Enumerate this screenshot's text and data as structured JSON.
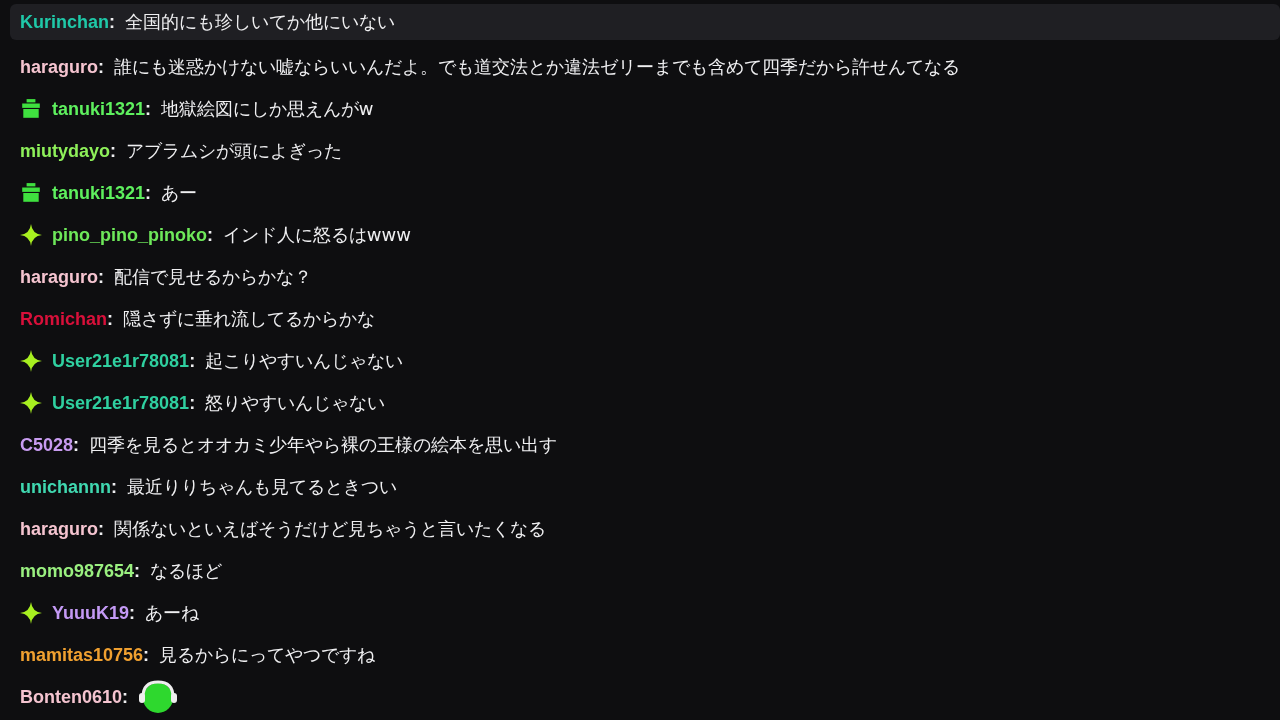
{
  "messages": [
    {
      "name": "Kurinchan",
      "color": "#1fc8a8",
      "kind": "plain",
      "text": "**:** 全国的にも珍しいてか他にいない",
      "highlighted": true
    },
    {
      "name": "haraguro",
      "color": "#f5c4d0",
      "kind": "plain",
      "text": "**:** 誰にも迷惑かけない嘘ならいいんだよ。でも道交法とか違法ゼリーまでも含めて四季だから許せんてなる",
      "highlighted": false
    },
    {
      "name": "tanuki1321",
      "color": "#5ef05e",
      "kind": "gift",
      "text": "**:** 地獄絵図にしか思えんがw",
      "highlighted": false
    },
    {
      "name": "miutydayo",
      "color": "#8ef05a",
      "kind": "plain",
      "text": "**:** アブラムシが頭によぎった",
      "highlighted": false
    },
    {
      "name": "tanuki1321",
      "color": "#5ef05e",
      "kind": "gift",
      "text": "**:** あー",
      "highlighted": false
    },
    {
      "name": "pino_pino_pinoko",
      "color": "#6ee85a",
      "kind": "sparkle",
      "text": "**:** インド人に怒るはwww",
      "highlighted": false
    },
    {
      "name": "haraguro",
      "color": "#f5c4d0",
      "kind": "plain",
      "text": "**:** 配信で見せるからかな？",
      "highlighted": false
    },
    {
      "name": "Romichan",
      "color": "#d8103a",
      "kind": "plain",
      "text": "**:** 隠さずに垂れ流してるからかな",
      "highlighted": false
    },
    {
      "name": "User21e1r78081",
      "color": "#2fd0a0",
      "kind": "sparkle",
      "text": "**:** 起こりやすいんじゃない",
      "highlighted": false
    },
    {
      "name": "User21e1r78081",
      "color": "#2fd0a0",
      "kind": "sparkle",
      "text": "**:** 怒りやすいんじゃない",
      "highlighted": false
    },
    {
      "name": "C5028",
      "color": "#c89cf0",
      "kind": "plain",
      "text": "**:** 四季を見るとオオカミ少年やら裸の王様の絵本を思い出す",
      "highlighted": false
    },
    {
      "name": "unichannn",
      "color": "#40d8b0",
      "kind": "plain",
      "text": "**:** 最近りりちゃんも見てるときつい",
      "highlighted": false
    },
    {
      "name": "haraguro",
      "color": "#f5c4d0",
      "kind": "plain",
      "text": "**:** 関係ないといえばそうだけど見ちゃうと言いたくなる",
      "highlighted": false
    },
    {
      "name": "momo987654",
      "color": "#9af080",
      "kind": "plain",
      "text": "**:** なるほど",
      "highlighted": false
    },
    {
      "name": "YuuuK19",
      "color": "#c49af5",
      "kind": "sparkle",
      "text": "**:** あーね",
      "highlighted": false
    },
    {
      "name": "mamitas10756",
      "color": "#f0a030",
      "kind": "plain",
      "text": "**:** 見るからにってやつですね",
      "highlighted": false
    },
    {
      "name": "Bonten0610",
      "color": "#f5c4d0",
      "kind": "plain",
      "text": "**:**",
      "emote": true,
      "highlighted": false
    }
  ]
}
